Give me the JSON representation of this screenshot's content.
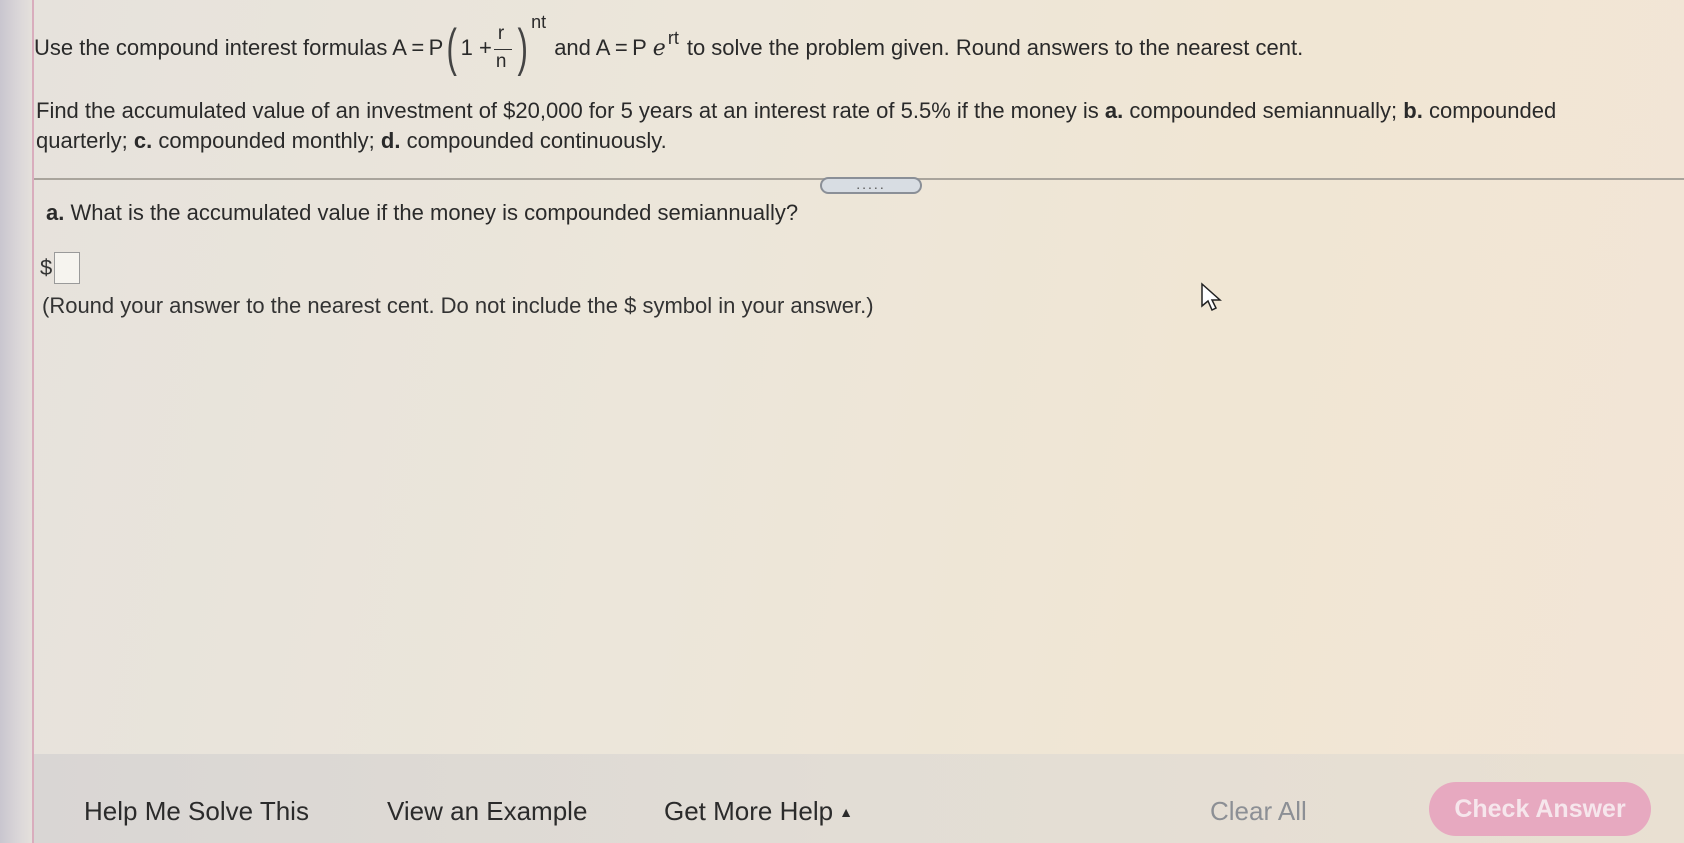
{
  "instructions": {
    "prefix": "Use the compound interest formulas A = P",
    "one_plus": "1 +",
    "frac_num": "r",
    "frac_den": "n",
    "exp1": "nt",
    "mid": "and A = P",
    "e": "e",
    "exp2": "rt",
    "suffix": "to solve the problem given. Round answers to the nearest cent."
  },
  "problem": {
    "text1": "Find the accumulated value of an investment of $20,000 for 5 years at an interest rate of 5.5% if the money is",
    "a_label": "a.",
    "a_text": "compounded semiannually;",
    "b_label": "b.",
    "b_text": "compounded",
    "b_text2": "quarterly;",
    "c_label": "c.",
    "c_text": "compounded monthly;",
    "d_label": "d.",
    "d_text": "compounded continuously."
  },
  "handle_dots": ".....",
  "question": {
    "label": "a.",
    "text": "What is the accumulated value if the money is compounded semiannually?"
  },
  "answer": {
    "currency": "$",
    "value": ""
  },
  "round_note": "(Round your answer to the nearest cent. Do not include the $ symbol in your answer.)",
  "footer": {
    "help": "Help Me Solve This",
    "example": "View an Example",
    "more_help": "Get More Help",
    "clear": "Clear All",
    "check": "Check Answer"
  },
  "colors": {
    "check_bg": "#e7a9c0",
    "accent_edge": "#d08aa8"
  }
}
